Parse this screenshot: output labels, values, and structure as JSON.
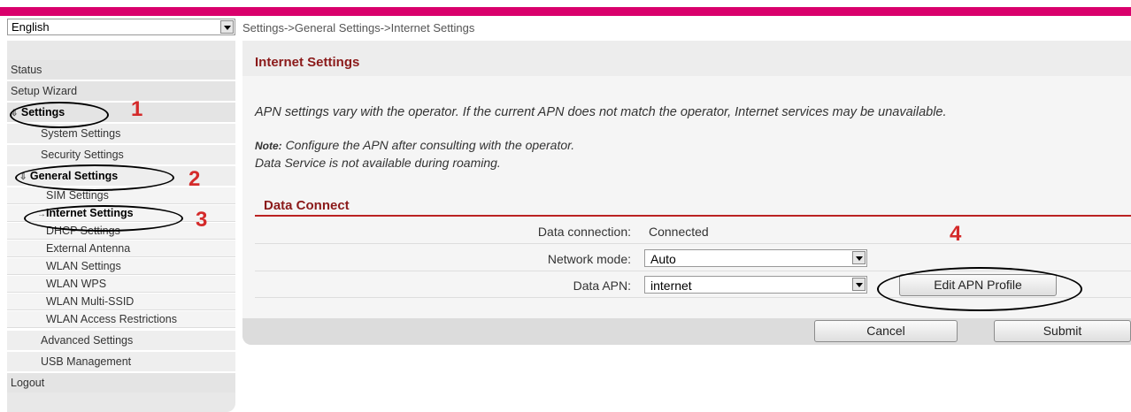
{
  "language": {
    "selected": "English"
  },
  "breadcrumb": "Settings->General Settings->Internet Settings",
  "sidebar": {
    "items": [
      {
        "label": "Status"
      },
      {
        "label": "Setup Wizard"
      },
      {
        "label": "Settings"
      },
      {
        "label": "System Settings"
      },
      {
        "label": "Security Settings"
      },
      {
        "label": "General Settings"
      },
      {
        "label": "SIM Settings"
      },
      {
        "label": "Internet Settings"
      },
      {
        "label": "DHCP Settings"
      },
      {
        "label": "External Antenna"
      },
      {
        "label": "WLAN Settings"
      },
      {
        "label": "WLAN WPS"
      },
      {
        "label": "WLAN Multi-SSID"
      },
      {
        "label": "WLAN Access Restrictions"
      },
      {
        "label": "Advanced Settings"
      },
      {
        "label": "USB Management"
      },
      {
        "label": "Logout"
      }
    ]
  },
  "page": {
    "title": "Internet Settings",
    "description": "APN settings vary with the operator. If the current APN does not match the operator, Internet services may be unavailable.",
    "note_label": "Note:",
    "note_text": "Configure the APN after consulting with the operator.",
    "note_line2": "Data Service is not available during roaming."
  },
  "data_connect": {
    "title": "Data Connect",
    "connection_label": "Data connection:",
    "connection_value": "Connected",
    "network_mode_label": "Network mode:",
    "network_mode_value": "Auto",
    "apn_label": "Data APN:",
    "apn_value": "internet",
    "edit_apn_label": "Edit APN Profile"
  },
  "actions": {
    "cancel": "Cancel",
    "submit": "Submit"
  },
  "annotations": [
    "1",
    "2",
    "3",
    "4"
  ],
  "colors": {
    "brand": "#d9006c",
    "heading": "#8b1a1a",
    "annotation": "#d42a2a"
  }
}
